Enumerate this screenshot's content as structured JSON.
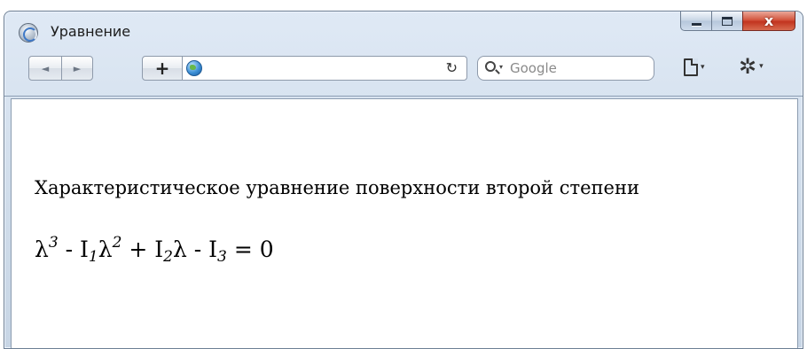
{
  "window": {
    "title": "Уравнение",
    "close_label": "x"
  },
  "toolbar": {
    "back_glyph": "◄",
    "forward_glyph": "►",
    "add_label": "+",
    "reload_glyph": "↻",
    "search_placeholder": "Google",
    "search_caret": "▾",
    "page_menu_caret": "▾",
    "gear_glyph": "✲",
    "gear_menu_caret": "▾"
  },
  "content": {
    "paragraph": "Характеристическое уравнение поверхности второй степени",
    "equation": {
      "lambda": "λ",
      "exp3": "3",
      "minus1": " - I",
      "sub1": "1",
      "lambda2": "λ",
      "exp2": "2",
      "plus": " + I",
      "sub2": "2",
      "lambda3": "λ",
      "minus2": " - I",
      "sub3": "3",
      "equals": " = 0"
    }
  },
  "icons": {
    "app": "browser-app-icon",
    "globe": "globe-icon",
    "search": "search-icon",
    "page": "page-icon",
    "gear": "gear-icon"
  }
}
